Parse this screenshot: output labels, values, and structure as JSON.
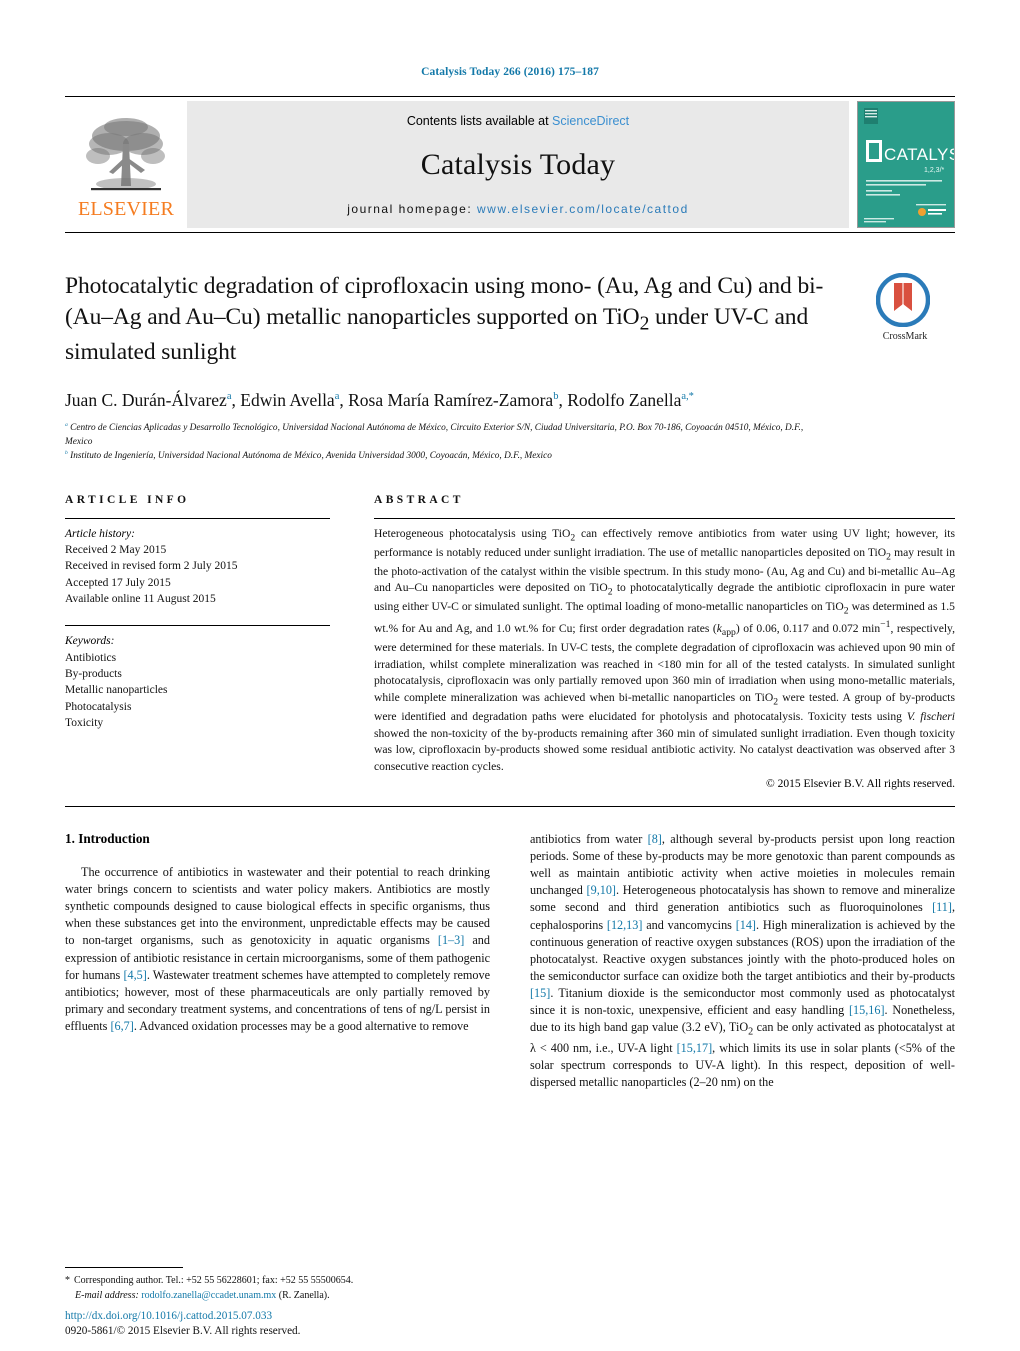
{
  "running_head": "Catalysis Today 266 (2016) 175–187",
  "masthead": {
    "publisher_name": "ELSEVIER",
    "contents_prefix": "Contents lists available at ",
    "contents_link": "ScienceDirect",
    "journal_name": "Catalysis Today",
    "homepage_prefix": "journal homepage: ",
    "homepage_url": "www.elsevier.com/locate/cattod",
    "cover_title": "CATALYSIS",
    "cover_volume": "1,2,3/*"
  },
  "title": "Photocatalytic degradation of ciprofloxacin using mono- (Au, Ag and Cu) and bi- (Au–Ag and Au–Cu) metallic nanoparticles supported on TiO2 under UV-C and simulated sunlight",
  "crossmark_label": "CrossMark",
  "authors": [
    {
      "name": "Juan C. Durán-Álvarez",
      "mark": "a"
    },
    {
      "name": "Edwin Avella",
      "mark": "a"
    },
    {
      "name": "Rosa María Ramírez-Zamora",
      "mark": "b"
    },
    {
      "name": "Rodolfo Zanella",
      "mark": "a,*"
    }
  ],
  "affiliations": [
    {
      "mark": "a",
      "text": "Centro de Ciencias Aplicadas y Desarrollo Tecnológico, Universidad Nacional Autónoma de México, Circuito Exterior S/N, Ciudad Universitaria, P.O. Box 70-186, Coyoacán 04510, México, D.F., Mexico"
    },
    {
      "mark": "b",
      "text": "Instituto de Ingeniería, Universidad Nacional Autónoma de México, Avenida Universidad 3000, Coyoacán, México, D.F., Mexico"
    }
  ],
  "article_info": {
    "heading": "ARTICLE INFO",
    "history_label": "Article history:",
    "history": [
      "Received 2 May 2015",
      "Received in revised form 2 July 2015",
      "Accepted 17 July 2015",
      "Available online 11 August 2015"
    ],
    "keywords_label": "Keywords:",
    "keywords": [
      "Antibiotics",
      "By-products",
      "Metallic nanoparticles",
      "Photocatalysis",
      "Toxicity"
    ]
  },
  "abstract": {
    "heading": "ABSTRACT",
    "text": "Heterogeneous photocatalysis using TiO2 can effectively remove antibiotics from water using UV light; however, its performance is notably reduced under sunlight irradiation. The use of metallic nanoparticles deposited on TiO2 may result in the photo-activation of the catalyst within the visible spectrum. In this study mono- (Au, Ag and Cu) and bi-metallic Au–Ag and Au–Cu nanoparticles were deposited on TiO2 to photocatalytically degrade the antibiotic ciprofloxacin in pure water using either UV-C or simulated sunlight. The optimal loading of mono-metallic nanoparticles on TiO2 was determined as 1.5 wt.% for Au and Ag, and 1.0 wt.% for Cu; first order degradation rates (kapp) of 0.06, 0.117 and 0.072 min−1, respectively, were determined for these materials. In UV-C tests, the complete degradation of ciprofloxacin was achieved upon 90 min of irradiation, whilst complete mineralization was reached in <180 min for all of the tested catalysts. In simulated sunlight photocatalysis, ciprofloxacin was only partially removed upon 360 min of irradiation when using mono-metallic materials, while complete mineralization was achieved when bi-metallic nanoparticles on TiO2 were tested. A group of by-products were identified and degradation paths were elucidated for photolysis and photocatalysis. Toxicity tests using V. fischeri showed the non-toxicity of the by-products remaining after 360 min of simulated sunlight irradiation. Even though toxicity was low, ciprofloxacin by-products showed some residual antibiotic activity. No catalyst deactivation was observed after 3 consecutive reaction cycles.",
    "copyright": "© 2015 Elsevier B.V. All rights reserved."
  },
  "introduction": {
    "heading": "1. Introduction",
    "left_paragraph": "The occurrence of antibiotics in wastewater and their potential to reach drinking water brings concern to scientists and water policy makers. Antibiotics are mostly synthetic compounds designed to cause biological effects in specific organisms, thus when these substances get into the environment, unpredictable effects may be caused to non-target organisms, such as genotoxicity in aquatic organisms [1–3] and expression of antibiotic resistance in certain microorganisms, some of them pathogenic for humans [4,5]. Wastewater treatment schemes have attempted to completely remove antibiotics; however, most of these pharmaceuticals are only partially removed by primary and secondary treatment systems, and concentrations of tens of ng/L persist in effluents [6,7]. Advanced oxidation processes may be a good alternative to remove",
    "right_paragraph": "antibiotics from water [8], although several by-products persist upon long reaction periods. Some of these by-products may be more genotoxic than parent compounds as well as maintain antibiotic activity when active moieties in molecules remain unchanged [9,10]. Heterogeneous photocatalysis has shown to remove and mineralize some second and third generation antibiotics such as fluoroquinolones [11], cephalosporins [12,13] and vancomycins [14]. High mineralization is achieved by the continuous generation of reactive oxygen substances (ROS) upon the irradiation of the photocatalyst. Reactive oxygen substances jointly with the photo-produced holes on the semiconductor surface can oxidize both the target antibiotics and their by-products [15]. Titanium dioxide is the semiconductor most commonly used as photocatalyst since it is non-toxic, unexpensive, efficient and easy handling [15,16]. Nonetheless, due to its high band gap value (3.2 eV), TiO2 can be only activated as photocatalyst at λ < 400 nm, i.e., UV-A light [15,17], which limits its use in solar plants (<5% of the solar spectrum corresponds to UV-A light). In this respect, deposition of well-dispersed metallic nanoparticles (2–20 nm) on the"
  },
  "footnote": {
    "star": "*",
    "corresponding": "Corresponding author. Tel.: +52 55 56228601; fax: +52 55 55500654.",
    "email_label": "E-mail address:",
    "email": "rodolfo.zanella@ccadet.unam.mx",
    "email_suffix": "(R. Zanella)."
  },
  "footer": {
    "doi": "http://dx.doi.org/10.1016/j.cattod.2015.07.033",
    "issn": "0920-5861/© 2015 Elsevier B.V. All rights reserved."
  },
  "colors": {
    "link": "#1278a8",
    "sciencedirect": "#3b8fd0",
    "elsevier_orange": "#f57c20",
    "cover_green": "#2a9d8a"
  }
}
